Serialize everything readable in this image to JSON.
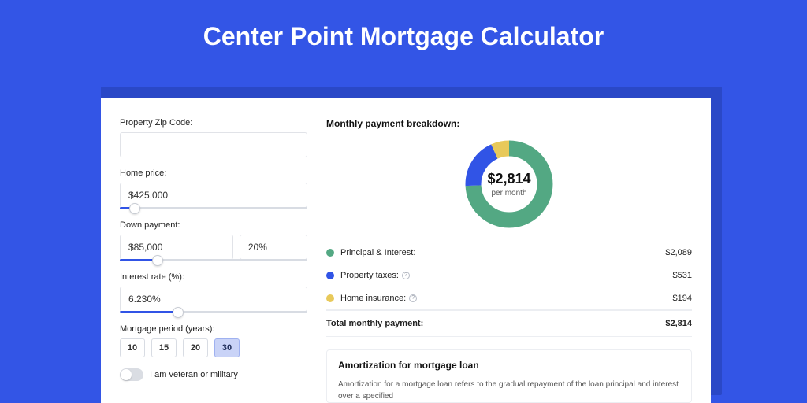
{
  "page_title": "Center Point Mortgage Calculator",
  "form": {
    "zip_label": "Property Zip Code:",
    "zip_value": "",
    "home_price_label": "Home price:",
    "home_price_value": "$425,000",
    "home_price_slider_pct": 8,
    "down_payment_label": "Down payment:",
    "down_payment_value": "$85,000",
    "down_payment_pct_value": "20%",
    "down_payment_slider_pct": 20,
    "interest_label": "Interest rate (%):",
    "interest_value": "6.230%",
    "interest_slider_pct": 31,
    "period_label": "Mortgage period (years):",
    "period_options": [
      "10",
      "15",
      "20",
      "30"
    ],
    "period_selected": "30",
    "veteran_label": "I am veteran or military",
    "veteran_on": false
  },
  "breakdown": {
    "title": "Monthly payment breakdown:",
    "center_value": "$2,814",
    "center_sub": "per month",
    "items": [
      {
        "label": "Principal & Interest:",
        "value": "$2,089",
        "color": "#53a883",
        "info": false
      },
      {
        "label": "Property taxes:",
        "value": "$531",
        "color": "#3154e6",
        "info": true
      },
      {
        "label": "Home insurance:",
        "value": "$194",
        "color": "#e8c95a",
        "info": true
      }
    ],
    "total_label": "Total monthly payment:",
    "total_value": "$2,814"
  },
  "amort": {
    "title": "Amortization for mortgage loan",
    "text": "Amortization for a mortgage loan refers to the gradual repayment of the loan principal and interest over a specified"
  },
  "chart_data": {
    "type": "pie",
    "title": "Monthly payment breakdown",
    "series": [
      {
        "name": "Principal & Interest",
        "value": 2089,
        "color": "#53a883"
      },
      {
        "name": "Property taxes",
        "value": 531,
        "color": "#3154e6"
      },
      {
        "name": "Home insurance",
        "value": 194,
        "color": "#e8c95a"
      }
    ],
    "total": 2814,
    "center_label": "$2,814 per month"
  }
}
